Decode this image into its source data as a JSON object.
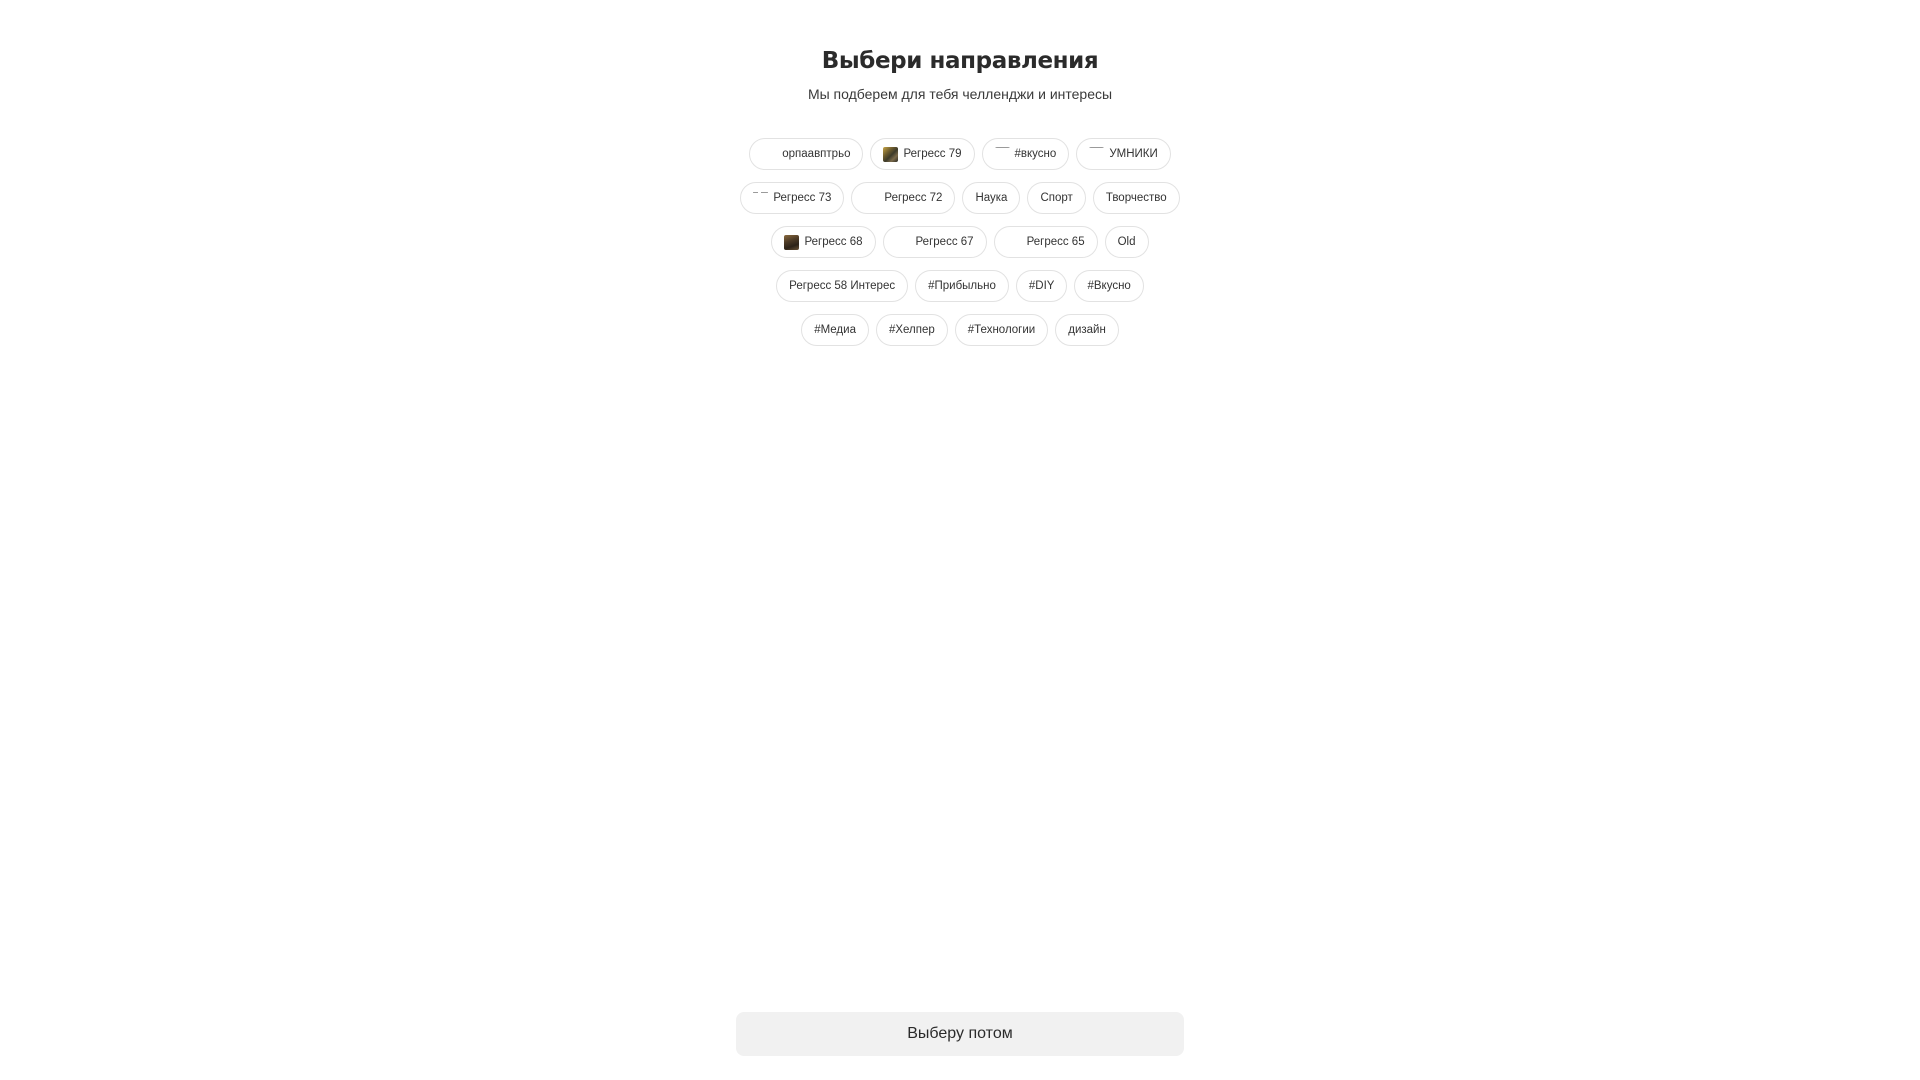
{
  "header": {
    "title": "Выбери направления",
    "subtitle": "Мы подберем для тебя челленджи и интересы"
  },
  "chips": {
    "rows": [
      [
        {
          "label": "орпаавптрьо",
          "thumb": "blank"
        },
        {
          "label": "Регресс 79",
          "thumb": "painting-1"
        },
        {
          "label": "#вкусно",
          "thumb": "line"
        },
        {
          "label": "УМНИКИ",
          "thumb": "line"
        }
      ],
      [
        {
          "label": "Регресс 73",
          "thumb": "dashes"
        },
        {
          "label": "Регресс 72",
          "thumb": "blank"
        },
        {
          "label": "Наука",
          "thumb": "none"
        },
        {
          "label": "Спорт",
          "thumb": "none"
        },
        {
          "label": "Творчество",
          "thumb": "none"
        }
      ],
      [
        {
          "label": "Регресс 68",
          "thumb": "painting-2"
        },
        {
          "label": "Регресс 67",
          "thumb": "blank"
        },
        {
          "label": "Регресс 65",
          "thumb": "blank"
        },
        {
          "label": "Old",
          "thumb": "none"
        }
      ],
      [
        {
          "label": "Регресс 58 Интерес",
          "thumb": "none"
        },
        {
          "label": "#Прибыльно",
          "thumb": "none"
        },
        {
          "label": "#DIY",
          "thumb": "none"
        },
        {
          "label": "#Вкусно",
          "thumb": "none"
        }
      ],
      [
        {
          "label": "#Медиа",
          "thumb": "none"
        },
        {
          "label": "#Хелпер",
          "thumb": "none"
        },
        {
          "label": "#Технологии",
          "thumb": "none"
        },
        {
          "label": "дизайн",
          "thumb": "none"
        }
      ]
    ]
  },
  "footer": {
    "skip_label": "Выберу потом"
  }
}
